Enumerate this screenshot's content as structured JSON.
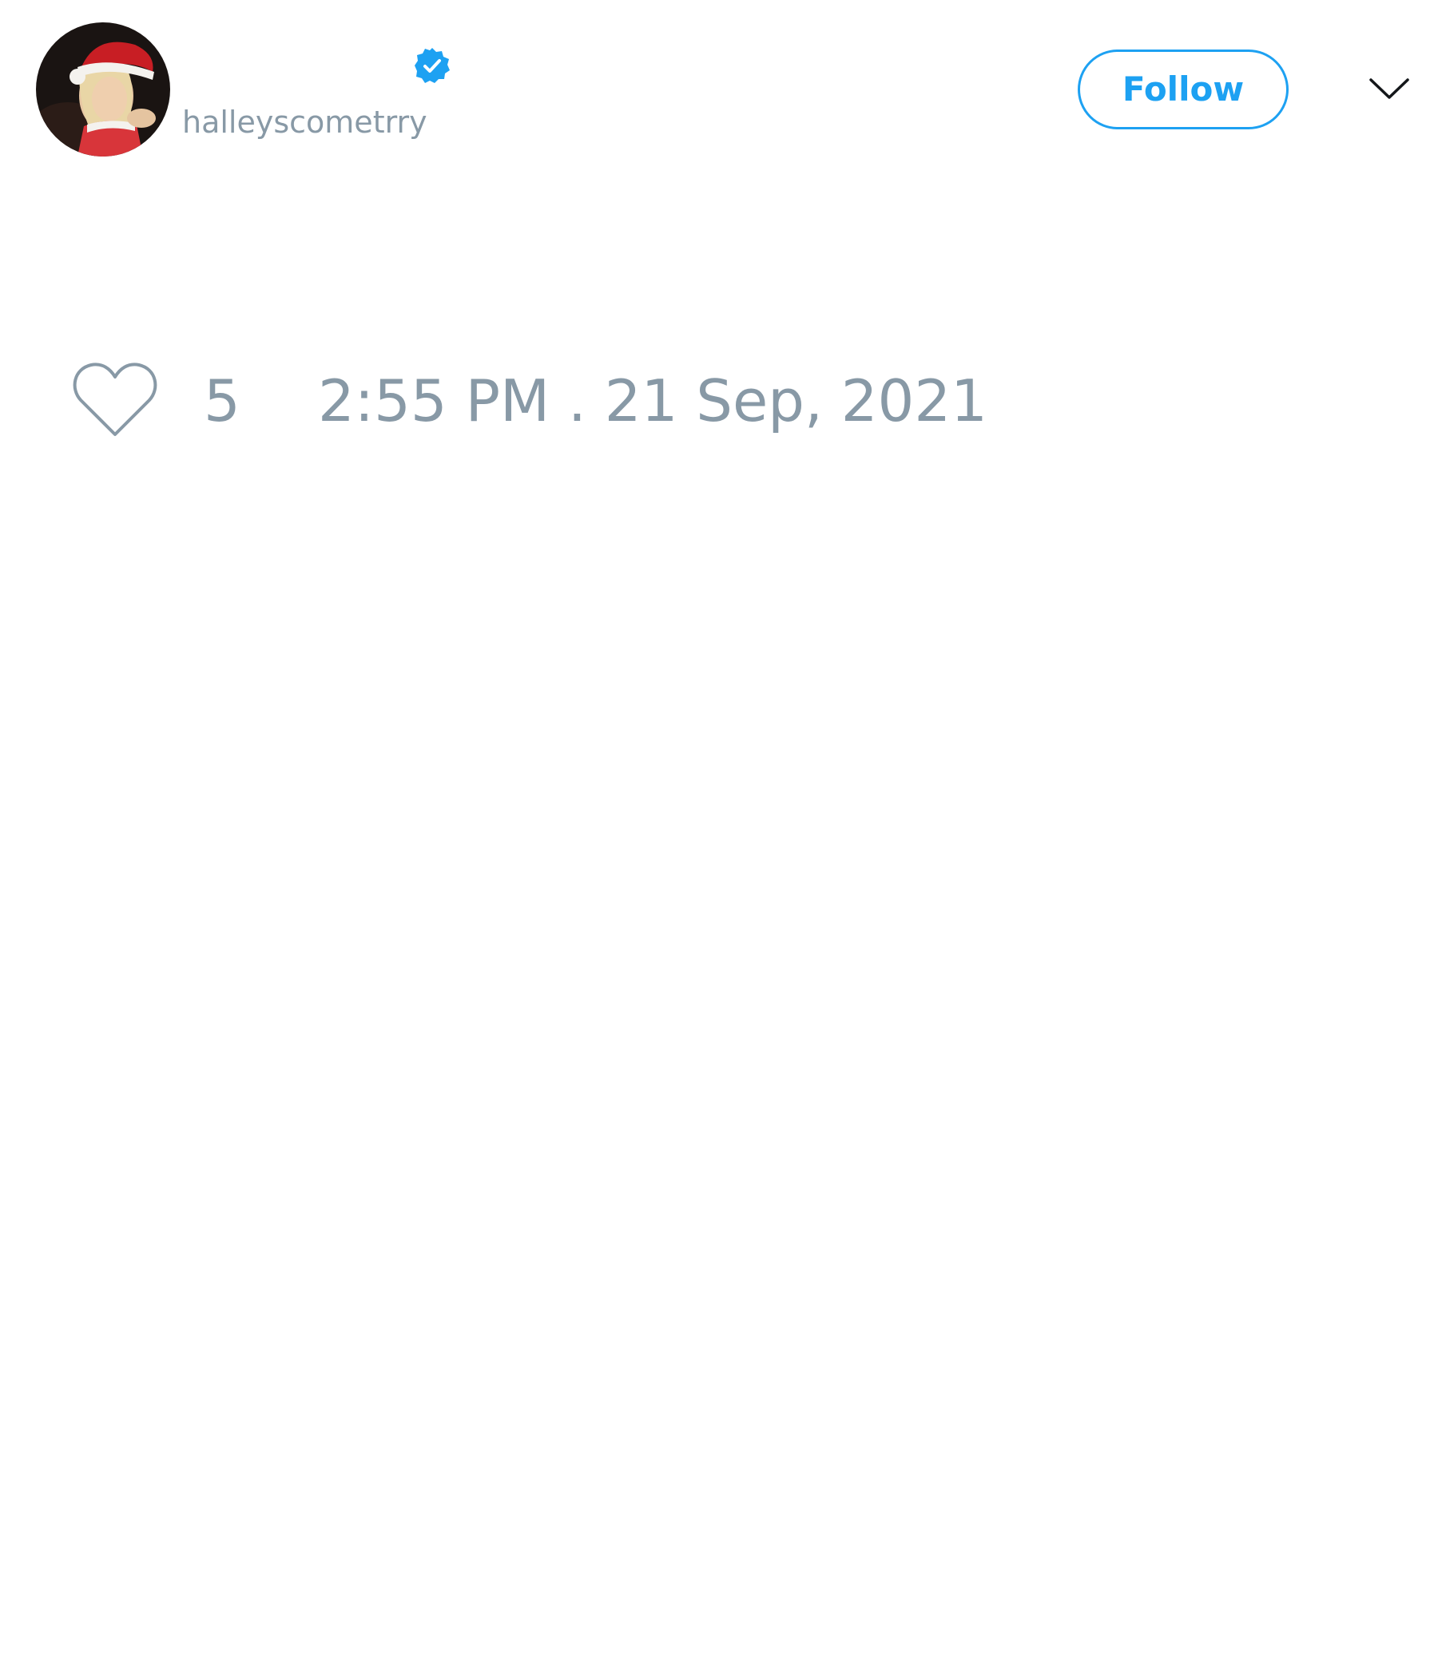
{
  "tweet": {
    "author": {
      "display_name": "",
      "handle": "halleyscometrry",
      "verified": true,
      "avatar_icon": "profile-photo"
    },
    "follow_label": "Follow",
    "menu_icon": "chevron-down-icon",
    "like_icon": "heart-outline-icon",
    "like_count": "5",
    "timestamp": "2:55 PM . 21 Sep, 2021"
  },
  "colors": {
    "accent": "#1da1f2",
    "muted_text": "#8899a6",
    "background": "#ffffff"
  }
}
